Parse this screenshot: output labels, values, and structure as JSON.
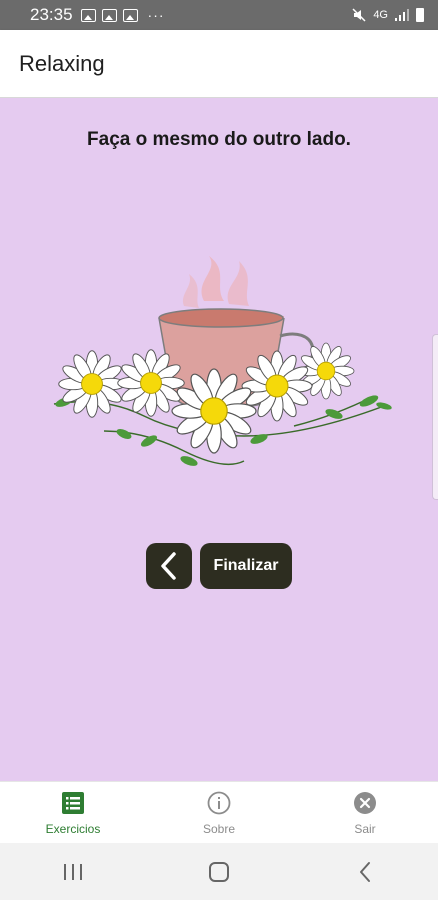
{
  "status_bar": {
    "time": "23:35",
    "more": "···",
    "network_label": "4G"
  },
  "app_bar": {
    "title": "Relaxing"
  },
  "content": {
    "instruction": "Faça o mesmo do outro lado.",
    "back_icon": "chevron-left-icon",
    "finish_label": "Finalizar"
  },
  "bottom_nav": {
    "items": [
      {
        "label": "Exercicios",
        "icon": "list-icon",
        "active": true
      },
      {
        "label": "Sobre",
        "icon": "info-icon",
        "active": false
      },
      {
        "label": "Sair",
        "icon": "close-icon",
        "active": false
      }
    ]
  },
  "colors": {
    "background": "#e5cbf0",
    "button": "#2d2d20",
    "active_nav": "#2e7d32",
    "inactive_nav": "#8c8c8c"
  }
}
